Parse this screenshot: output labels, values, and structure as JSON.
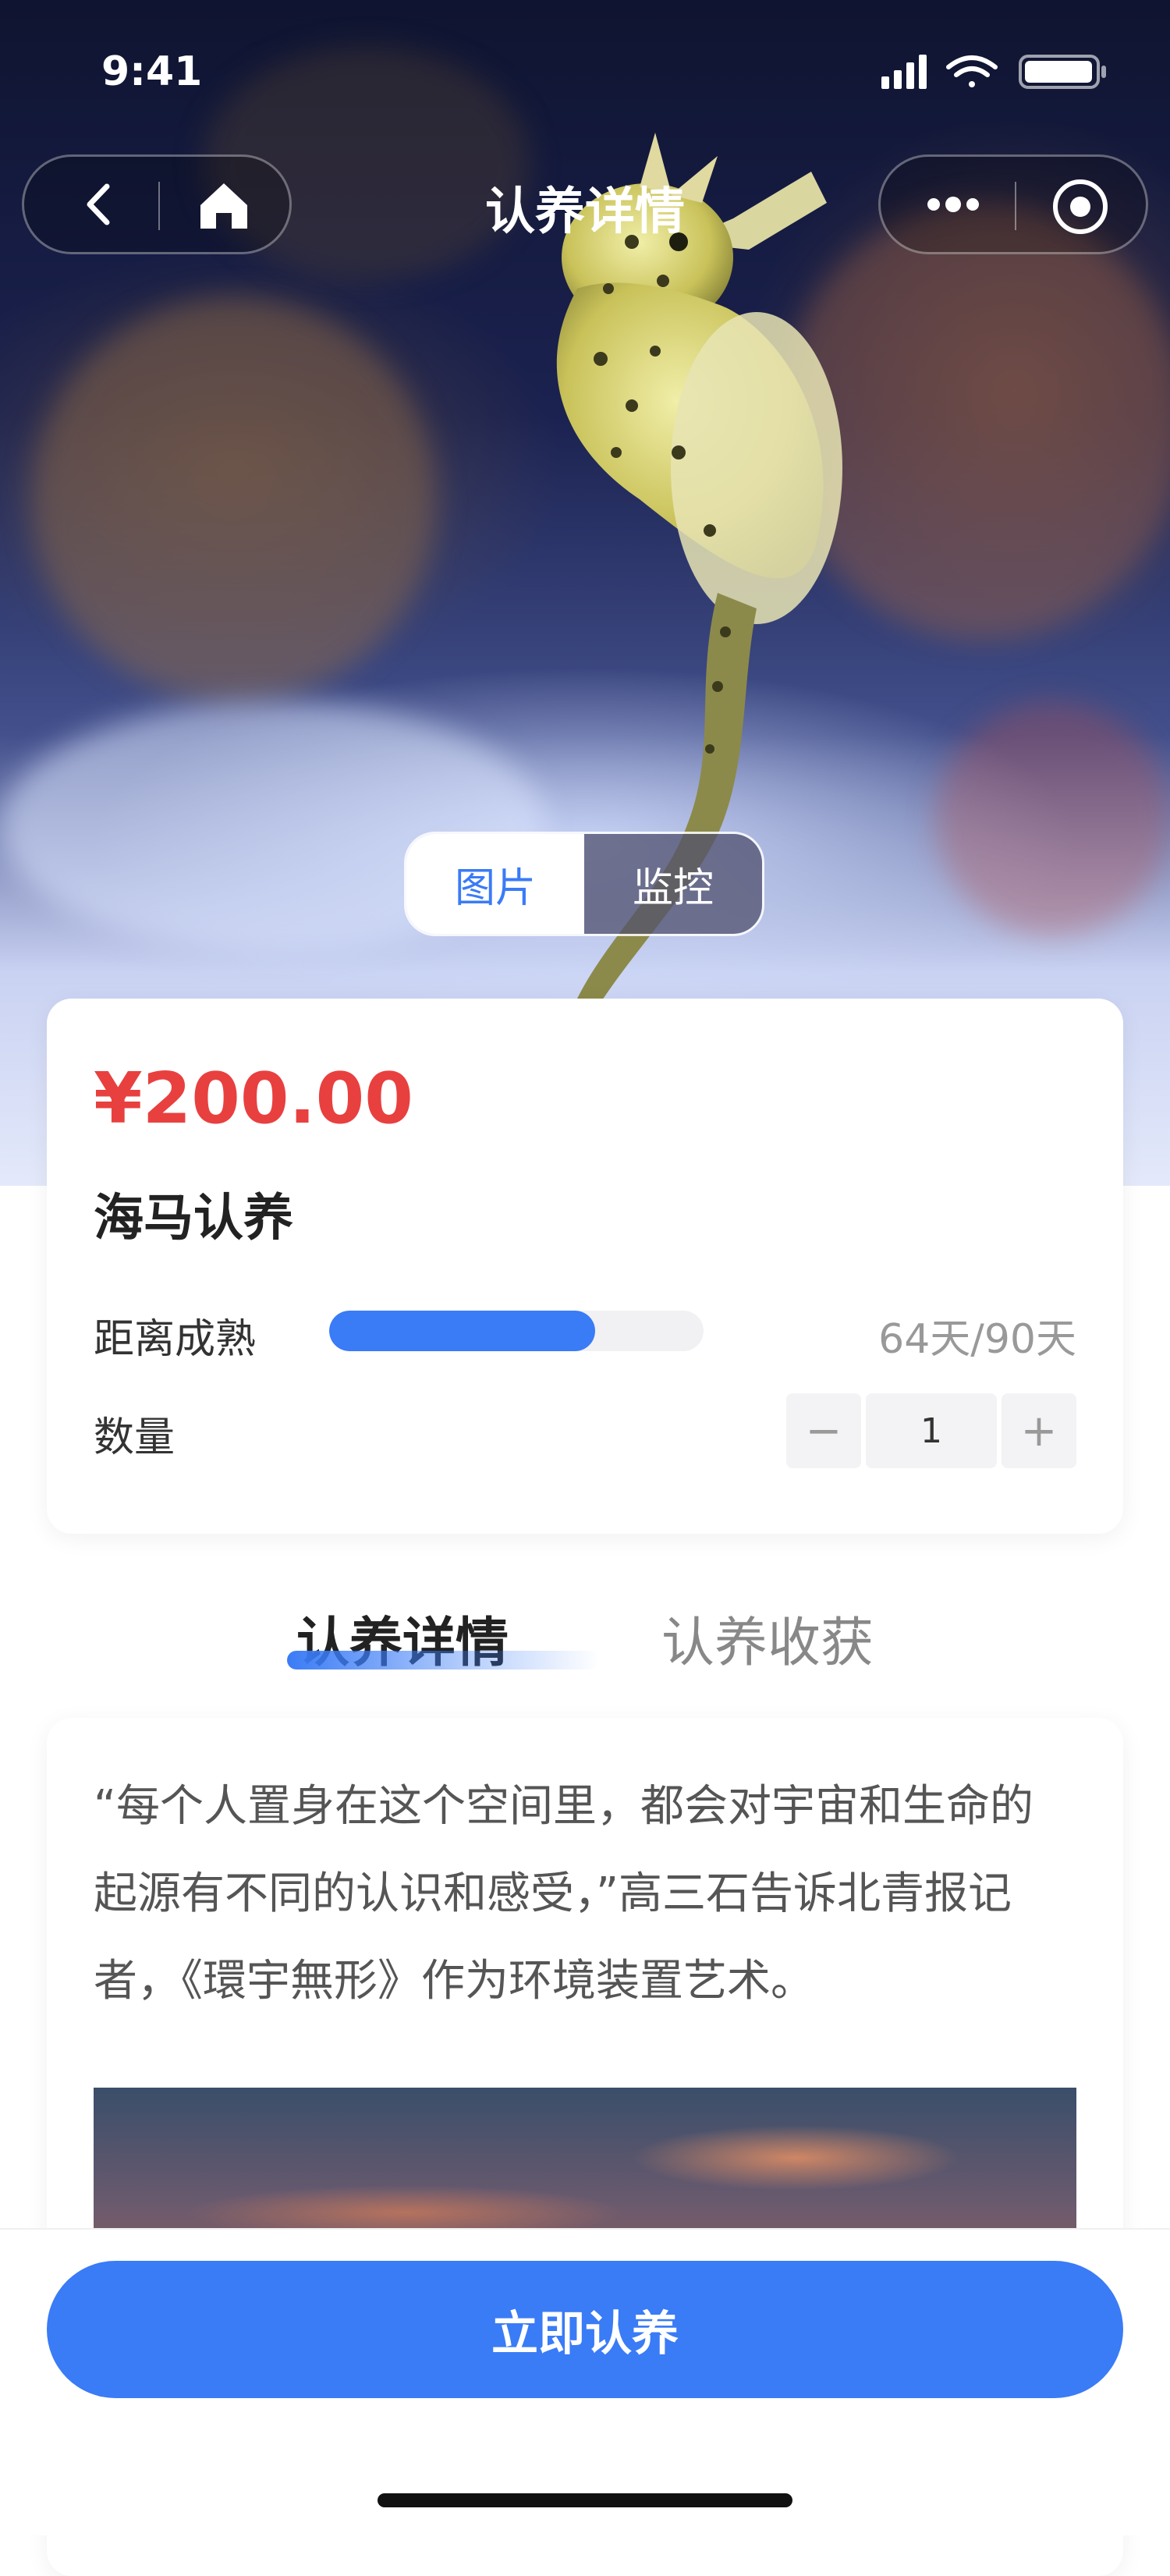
{
  "status_bar": {
    "time": "9:41"
  },
  "nav": {
    "title": "认养详情",
    "icons": [
      "back-icon",
      "home-icon",
      "more-icon",
      "target-icon"
    ]
  },
  "media_toggle": {
    "options": [
      "图片",
      "监控"
    ],
    "active": "图片"
  },
  "product": {
    "price": "¥200.00",
    "name": "海马认养",
    "maturity_label": "距离成熟",
    "maturity_text": "64天/90天",
    "maturity_fraction": 0.711,
    "quantity_label": "数量",
    "quantity_value": "1",
    "minus": "−",
    "plus": "+"
  },
  "tabs": {
    "active": "认养详情",
    "inactive": "认养收获"
  },
  "detail": {
    "paragraph": "“每个人置身在这个空间里，都会对宇宙和生命的起源有不同的认识和感受，”高三石告诉北青报记者，《環宇無形》作为环境装置艺术。"
  },
  "cta": {
    "label": "立即认养"
  },
  "colors": {
    "accent": "#3a7bf6",
    "price": "#e8403f"
  }
}
